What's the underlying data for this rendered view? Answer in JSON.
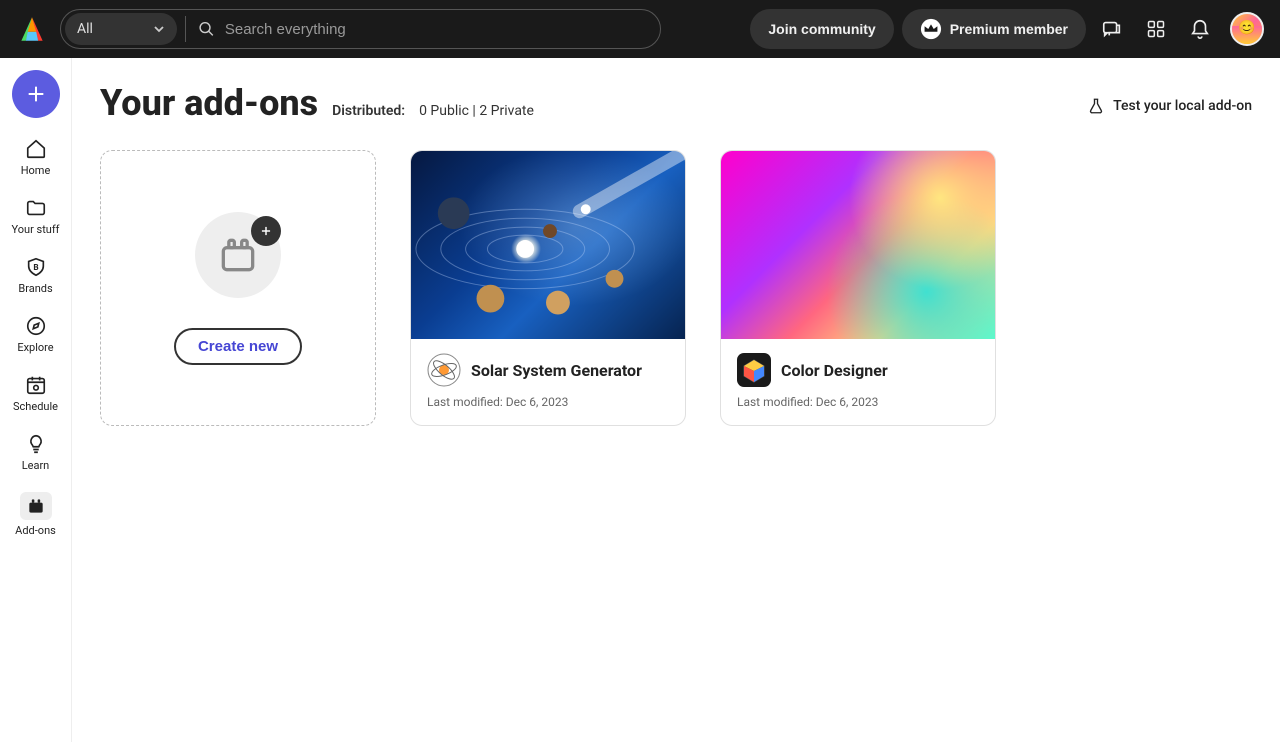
{
  "topbar": {
    "filter_label": "All",
    "search_placeholder": "Search everything",
    "join_community": "Join community",
    "premium_member": "Premium member"
  },
  "sidebar": {
    "items": [
      {
        "label": "Home"
      },
      {
        "label": "Your stuff"
      },
      {
        "label": "Brands"
      },
      {
        "label": "Explore"
      },
      {
        "label": "Schedule"
      },
      {
        "label": "Learn"
      },
      {
        "label": "Add-ons"
      }
    ]
  },
  "page": {
    "title": "Your add-ons",
    "distributed_label": "Distributed:",
    "distributed_values": "0 Public | 2 Private",
    "test_local": "Test your local add-on",
    "create_new": "Create new"
  },
  "addons": [
    {
      "title": "Solar System Generator",
      "modified": "Last modified: Dec 6, 2023"
    },
    {
      "title": "Color Designer",
      "modified": "Last modified: Dec 6, 2023"
    }
  ]
}
